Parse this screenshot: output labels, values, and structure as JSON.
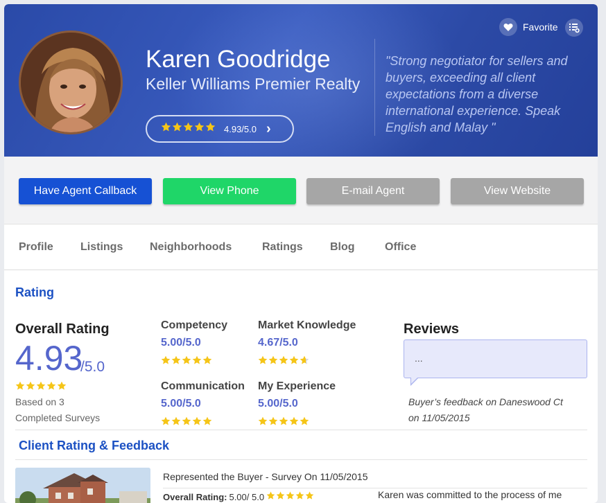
{
  "agent": {
    "name": "Karen Goodridge",
    "company": "Keller Williams Premier Realty",
    "rating_text": "4.93/5.0",
    "rating_stars": 5,
    "quote": "\"Strong negotiator for sellers and buyers, exceeding all client expectations from a diverse international experience. Speak English and Malay \""
  },
  "header_actions": {
    "favorite_label": "Favorite",
    "favorite_icon": "heart-icon",
    "list_icon": "add-to-list-icon"
  },
  "actions": {
    "callback": "Have Agent Callback",
    "phone": "View Phone",
    "email": "E-mail Agent",
    "website": "View Website"
  },
  "tabs": [
    "Profile",
    "Listings",
    "Neighborhoods",
    "Ratings",
    "Blog",
    "Office"
  ],
  "rating_section": {
    "title": "Rating",
    "overall_label": "Overall Rating",
    "overall_value": "4.93",
    "overall_denominator": "/5.0",
    "based_on": "Based on 3",
    "completed": "Completed Surveys",
    "criteria": [
      {
        "name": "Competency",
        "value": "5.00/5.0",
        "stars": 5
      },
      {
        "name": "Market Knowledge",
        "value": "4.67/5.0",
        "stars": 4.67
      },
      {
        "name": "Communication",
        "value": "5.00/5.0",
        "stars": 5
      },
      {
        "name": "My Experience",
        "value": "5.00/5.0",
        "stars": 5
      }
    ]
  },
  "reviews": {
    "title": "Reviews",
    "snippet": "...",
    "meta_line1": "Buyer’s feedback on Daneswood Ct",
    "meta_line2": "on 11/05/2015"
  },
  "feedback": {
    "title": "Client Rating & Feedback",
    "survey_header": "Represented the Buyer - Survey On 11/05/2015",
    "overall_label": "Overall Rating:",
    "overall_value": "5.00/ 5.0",
    "text": "Karen was committed to the process of me"
  },
  "colors": {
    "hero": "#2c4aa6",
    "accent": "#1c51c3",
    "rating_value": "#5566cc",
    "star": "#f5c518",
    "callback_btn": "#1651d4",
    "phone_btn": "#1fd668",
    "grey_btn": "#a6a6a6"
  }
}
